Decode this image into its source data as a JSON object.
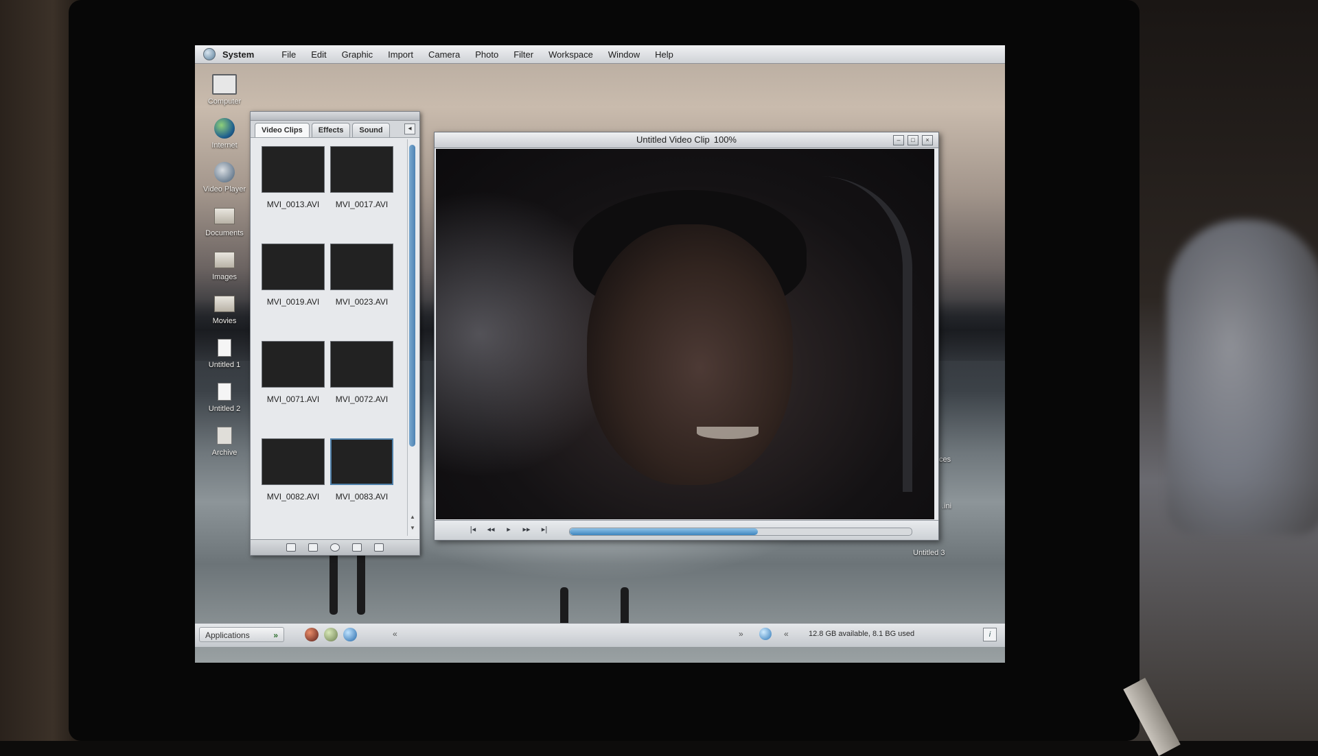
{
  "menubar": {
    "system_name": "System",
    "items": [
      "File",
      "Edit",
      "Graphic",
      "Import",
      "Camera",
      "Photo",
      "Filter",
      "Workspace",
      "Window",
      "Help"
    ]
  },
  "desktop": {
    "icons": [
      {
        "label": "Computer",
        "icon": "computer-icon"
      },
      {
        "label": "Internet",
        "icon": "globe-icon"
      },
      {
        "label": "Video Player",
        "icon": "video-player-icon"
      },
      {
        "label": "Documents",
        "icon": "folder-icon"
      },
      {
        "label": "Images",
        "icon": "folder-icon"
      },
      {
        "label": "Movies",
        "icon": "folder-icon"
      },
      {
        "label": "Untitled 1",
        "icon": "file-icon"
      },
      {
        "label": "Untitled 2",
        "icon": "file-icon"
      },
      {
        "label": "Archive",
        "icon": "archive-icon"
      }
    ],
    "partial_labels": [
      "ces",
      ".ini",
      "Untitled 3"
    ]
  },
  "clips_panel": {
    "tabs": [
      "Video Clips",
      "Effects",
      "Sound"
    ],
    "active_tab": "Video Clips",
    "collapse_glyph": "◂",
    "clips": [
      {
        "name": "MVI_0013.AVI",
        "selected": false
      },
      {
        "name": "MVI_0017.AVI",
        "selected": false
      },
      {
        "name": "MVI_0019.AVI",
        "selected": false
      },
      {
        "name": "MVI_0023.AVI",
        "selected": false
      },
      {
        "name": "MVI_0071.AVI",
        "selected": false
      },
      {
        "name": "MVI_0072.AVI",
        "selected": false
      },
      {
        "name": "MVI_0082.AVI",
        "selected": false
      },
      {
        "name": "MVI_0083.AVI",
        "selected": true
      }
    ],
    "footer_icons": [
      "new-icon",
      "folder-icon",
      "info-icon",
      "play-icon",
      "trash-icon"
    ]
  },
  "video_window": {
    "title": "Untitled Video Clip",
    "zoom": "100%",
    "buttons": {
      "minimize": "–",
      "maximize": "□",
      "close": "×"
    },
    "transport": {
      "first": "|◂",
      "rewind": "◂◂",
      "play": "▸",
      "forward": "▸▸",
      "last": "▸|"
    },
    "progress_fraction": 0.55
  },
  "dock": {
    "applications_label": "Applications",
    "applications_chevron": "»",
    "collapse_left": "«",
    "expand_right": "»",
    "collapse_right": "«",
    "status_text": "12.8 GB available, 8.1 BG used",
    "info_glyph": "i"
  },
  "colors": {
    "accent": "#4e83b3",
    "selection_border": "#4e7fa8"
  }
}
